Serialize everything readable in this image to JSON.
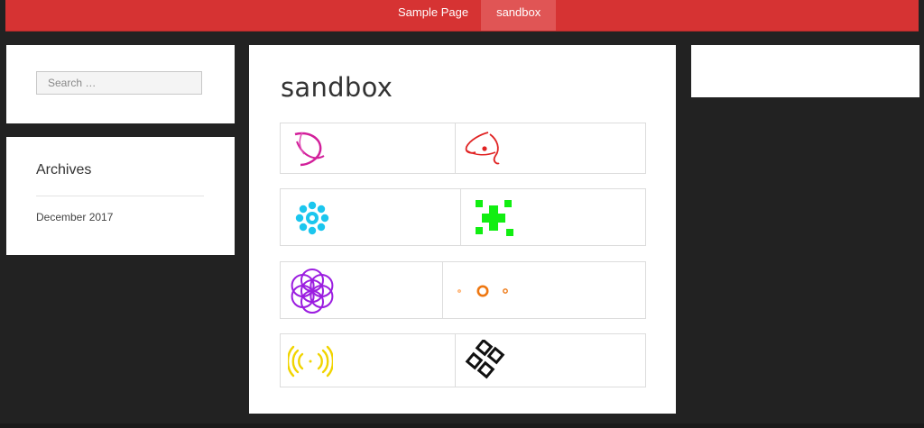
{
  "nav": {
    "items": [
      {
        "label": "Sample Page"
      },
      {
        "label": "sandbox"
      }
    ]
  },
  "search": {
    "placeholder": "Search …"
  },
  "archives": {
    "title": "Archives",
    "links": [
      "December 2017"
    ]
  },
  "page": {
    "title": "sandbox"
  },
  "gallery": {
    "rows": [
      {
        "icons": [
          "magenta-orbit-icon",
          "red-atom-icon"
        ]
      },
      {
        "icons": [
          "cyan-flower-icon",
          "green-cross-icon"
        ]
      },
      {
        "icons": [
          "purple-flower-of-life-icon",
          "orange-rings-icon"
        ]
      },
      {
        "icons": [
          "yellow-signal-waves-icon",
          "black-diamond-grid-icon"
        ]
      }
    ]
  },
  "colors": {
    "header": "#d63333",
    "active_nav": "#e05555",
    "background": "#222222",
    "card": "#ffffff"
  }
}
